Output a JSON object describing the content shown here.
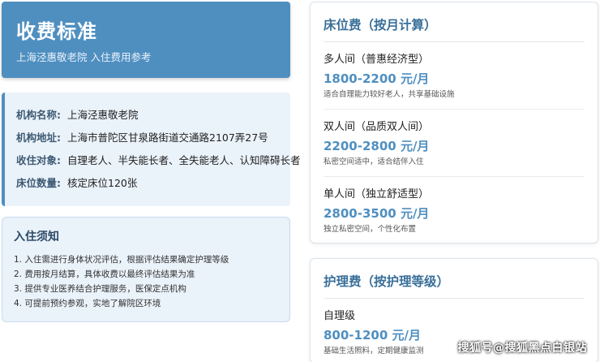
{
  "header": {
    "title": "收费标准",
    "subtitle": "上海泾惠敬老院 入住费用参考"
  },
  "info": [
    {
      "key": "机构名称:",
      "value": "上海泾惠敬老院"
    },
    {
      "key": "机构地址:",
      "value": "上海市普陀区甘泉路街道交通路2107弄27号"
    },
    {
      "key": "收住对象:",
      "value": "自理老人、半失能长者、全失能老人、认知障碍长者"
    },
    {
      "key": "床位数量:",
      "value": "核定床位120张"
    }
  ],
  "notice": {
    "title": "入住须知",
    "items": [
      "1. 入住需进行身体状况评估，根据评估结果确定护理等级",
      "2. 费用按月结算，具体收费以最终评估结果为准",
      "3. 提供专业医养结合护理服务，医保定点机构",
      "4. 可提前预约参观，实地了解院区环境"
    ]
  },
  "bed_fee": {
    "title": "床位费（按月计算）",
    "tiers": [
      {
        "name": "多人间（普惠经济型）",
        "price": "1800-2200 元/月",
        "desc": "适合自理能力较好老人，共享基础设施"
      },
      {
        "name": "双人间（品质双人间）",
        "price": "2200-2800 元/月",
        "desc": "私密空间适中，适合结伴入住"
      },
      {
        "name": "单人间（独立舒适型）",
        "price": "2800-3500 元/月",
        "desc": "独立私密空间，个性化布置"
      }
    ]
  },
  "care_fee": {
    "title": "护理费（按护理等级）",
    "tiers": [
      {
        "name": "自理级",
        "price": "800-1200 元/月",
        "desc": "基础生活照料，定期健康监测"
      }
    ]
  },
  "watermark": "搜狐号@搜狐黑点白银站"
}
